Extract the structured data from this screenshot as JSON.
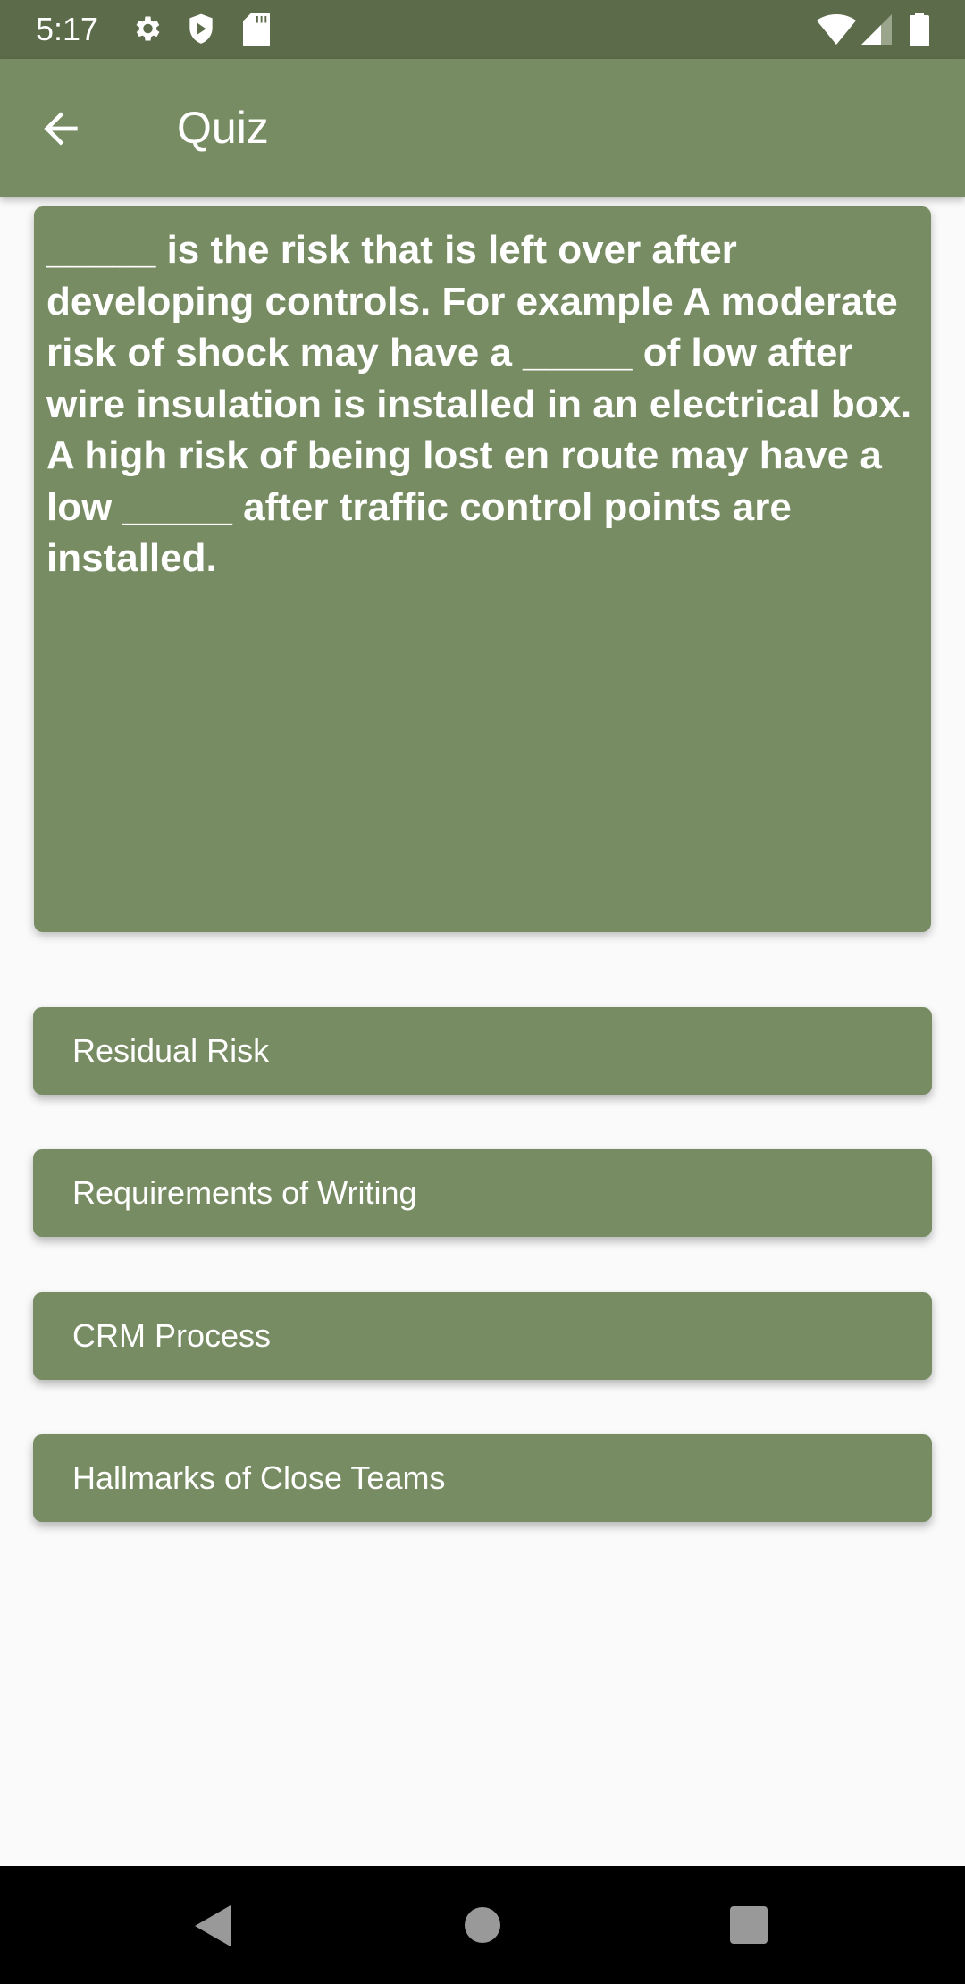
{
  "status_bar": {
    "time": "5:17",
    "left_icons": [
      "gear-icon",
      "shield-play-icon",
      "sd-card-icon"
    ],
    "right_icons": [
      "wifi-icon",
      "signal-icon",
      "battery-icon"
    ]
  },
  "app_bar": {
    "back_icon": "arrow-left-icon",
    "title": "Quiz"
  },
  "question": {
    "text": "_____ is the risk that is left over after developing controls. For example A moderate risk of shock may have a _____ of low after wire insulation is installed in an electrical box. A high risk of being lost en route may have a low _____ after traffic control points are installed."
  },
  "answers": [
    {
      "label": "Residual Risk"
    },
    {
      "label": "Requirements of Writing"
    },
    {
      "label": "CRM Process"
    },
    {
      "label": "Hallmarks of Close Teams"
    }
  ],
  "nav_bar": {
    "buttons": [
      "back-triangle-icon",
      "home-circle-icon",
      "recents-square-icon"
    ]
  },
  "colors": {
    "primary": "#778c62",
    "primary_dark": "#5c6b4a",
    "background": "#fafafa"
  }
}
